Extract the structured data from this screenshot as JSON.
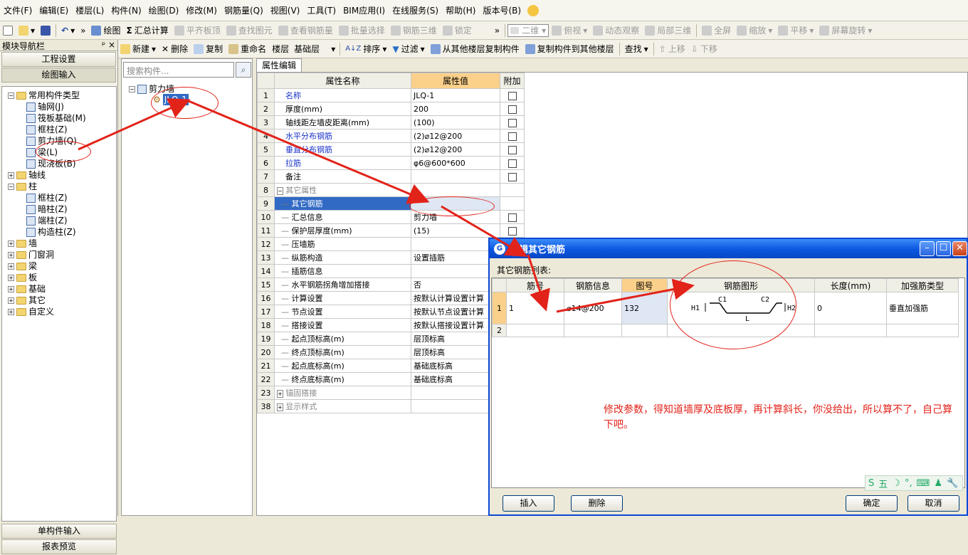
{
  "menu": [
    "文件(F)",
    "编辑(E)",
    "楼层(L)",
    "构件(N)",
    "绘图(D)",
    "修改(M)",
    "钢筋量(Q)",
    "视图(V)",
    "工具(T)",
    "BIM应用(I)",
    "在线服务(S)",
    "帮助(H)",
    "版本号(B)"
  ],
  "toolbar1": {
    "draw": "绘图",
    "calc": "汇总计算",
    "align_slab": "平齐板顶",
    "find_elem": "查找图元",
    "view_rebar": "查看钢筋量",
    "batch_select": "批量选择",
    "rebar_3d": "钢筋三维",
    "lock": "锁定",
    "view_mode": "二维",
    "top_view": "俯视",
    "dynamic_view": "动态观察",
    "local_3d": "局部三维",
    "fullscreen": "全屏",
    "zoom": "缩放",
    "pan": "平移",
    "rotate": "屏幕旋转"
  },
  "toolbar2": {
    "new": "新建",
    "delete": "删除",
    "copy": "复制",
    "rename": "重命名",
    "floor_label": "楼层",
    "floor_value": "基础层",
    "sort": "排序",
    "filter": "过滤",
    "copy_from": "从其他楼层复制构件",
    "copy_to": "复制构件到其他楼层",
    "find": "查找",
    "move_up": "上移",
    "move_down": "下移"
  },
  "nav": {
    "title": "模块导航栏",
    "pin": "ᵖ",
    "close": "×",
    "project_settings": "工程设置",
    "drawing_input": "绘图输入",
    "single_input": "单构件输入",
    "report_preview": "报表预览",
    "tree": [
      {
        "label": "常用构件类型",
        "level": 0,
        "type": "folder",
        "exp": "−"
      },
      {
        "label": "轴网(J)",
        "level": 1,
        "type": "comp"
      },
      {
        "label": "筏板基础(M)",
        "level": 1,
        "type": "comp"
      },
      {
        "label": "框柱(Z)",
        "level": 1,
        "type": "comp"
      },
      {
        "label": "剪力墙(Q)",
        "level": 1,
        "type": "comp"
      },
      {
        "label": "梁(L)",
        "level": 1,
        "type": "comp"
      },
      {
        "label": "现浇板(B)",
        "level": 1,
        "type": "comp"
      },
      {
        "label": "轴线",
        "level": 0,
        "type": "folder",
        "exp": "+"
      },
      {
        "label": "柱",
        "level": 0,
        "type": "folder",
        "exp": "−"
      },
      {
        "label": "框柱(Z)",
        "level": 1,
        "type": "comp"
      },
      {
        "label": "暗柱(Z)",
        "level": 1,
        "type": "comp"
      },
      {
        "label": "端柱(Z)",
        "level": 1,
        "type": "comp"
      },
      {
        "label": "构造柱(Z)",
        "level": 1,
        "type": "comp"
      },
      {
        "label": "墙",
        "level": 0,
        "type": "folder",
        "exp": "+"
      },
      {
        "label": "门窗洞",
        "level": 0,
        "type": "folder",
        "exp": "+"
      },
      {
        "label": "梁",
        "level": 0,
        "type": "folder",
        "exp": "+"
      },
      {
        "label": "板",
        "level": 0,
        "type": "folder",
        "exp": "+"
      },
      {
        "label": "基础",
        "level": 0,
        "type": "folder",
        "exp": "+"
      },
      {
        "label": "其它",
        "level": 0,
        "type": "folder",
        "exp": "+"
      },
      {
        "label": "自定义",
        "level": 0,
        "type": "folder",
        "exp": "+"
      }
    ]
  },
  "components": {
    "search_placeholder": "搜索构件...",
    "root": "剪力墙",
    "root_exp": "−",
    "item": "JLQ-1"
  },
  "props": {
    "tab": "属性编辑",
    "col_name": "属性名称",
    "col_value": "属性值",
    "col_extra": "附加",
    "rows": [
      {
        "n": "1",
        "name": "名称",
        "value": "JLQ-1",
        "chk": false,
        "blue": true,
        "indent": 0
      },
      {
        "n": "2",
        "name": "厚度(mm)",
        "value": "200",
        "chk": true,
        "indent": 0
      },
      {
        "n": "3",
        "name": "轴线距左墙皮距离(mm)",
        "value": "(100)",
        "chk": true,
        "indent": 0
      },
      {
        "n": "4",
        "name": "水平分布钢筋",
        "value": "(2)⌀12@200",
        "chk": true,
        "blue": true,
        "indent": 0
      },
      {
        "n": "5",
        "name": "垂直分布钢筋",
        "value": "(2)⌀12@200",
        "chk": true,
        "blue": true,
        "indent": 0
      },
      {
        "n": "6",
        "name": "拉筋",
        "value": "φ6@600*600",
        "chk": true,
        "blue": true,
        "indent": 0
      },
      {
        "n": "7",
        "name": "备注",
        "value": "",
        "chk": true,
        "indent": 0
      },
      {
        "n": "8",
        "name": "其它属性",
        "value": "",
        "chk": null,
        "gray": true,
        "indent": 0,
        "exp": "−"
      },
      {
        "n": "9",
        "name": "其它钢筋",
        "value": "",
        "chk": null,
        "indent": 1,
        "sel": true
      },
      {
        "n": "10",
        "name": "汇总信息",
        "value": "剪力墙",
        "chk": true,
        "indent": 1
      },
      {
        "n": "11",
        "name": "保护层厚度(mm)",
        "value": "(15)",
        "chk": true,
        "indent": 1
      },
      {
        "n": "12",
        "name": "压墙筋",
        "value": "",
        "chk": true,
        "indent": 1
      },
      {
        "n": "13",
        "name": "纵筋构造",
        "value": "设置插筋",
        "chk": true,
        "indent": 1
      },
      {
        "n": "14",
        "name": "插筋信息",
        "value": "",
        "chk": true,
        "indent": 1
      },
      {
        "n": "15",
        "name": "水平钢筋拐角增加搭接",
        "value": "否",
        "chk": true,
        "indent": 1
      },
      {
        "n": "16",
        "name": "计算设置",
        "value": "按默认计算设置计算",
        "chk": null,
        "indent": 1
      },
      {
        "n": "17",
        "name": "节点设置",
        "value": "按默认节点设置计算",
        "chk": null,
        "indent": 1
      },
      {
        "n": "18",
        "name": "搭接设置",
        "value": "按默认搭接设置计算",
        "chk": null,
        "indent": 1
      },
      {
        "n": "19",
        "name": "起点顶标高(m)",
        "value": "层顶标高",
        "chk": null,
        "indent": 1
      },
      {
        "n": "20",
        "name": "终点顶标高(m)",
        "value": "层顶标高",
        "chk": null,
        "indent": 1
      },
      {
        "n": "21",
        "name": "起点底标高(m)",
        "value": "基础底标高",
        "chk": null,
        "indent": 1
      },
      {
        "n": "22",
        "name": "终点底标高(m)",
        "value": "基础底标高",
        "chk": null,
        "indent": 1
      },
      {
        "n": "23",
        "name": "锚固搭接",
        "value": "",
        "chk": null,
        "gray": true,
        "indent": 0,
        "exp": "+"
      },
      {
        "n": "38",
        "name": "显示样式",
        "value": "",
        "chk": null,
        "gray": true,
        "indent": 0,
        "exp": "+"
      }
    ]
  },
  "dialog": {
    "title": "编辑其它钢筋",
    "list_label": "其它钢筋列表:",
    "columns": [
      "筋号",
      "钢筋信息",
      "图号",
      "钢筋图形",
      "长度(mm)",
      "加强筋类型"
    ],
    "rows": [
      {
        "n": "1",
        "bar": "1",
        "info": "⌀14@200",
        "fig": "132",
        "len": "0",
        "type": "垂直加强筋"
      },
      {
        "n": "2",
        "bar": "",
        "info": "",
        "fig": "",
        "len": "",
        "type": ""
      }
    ],
    "shape": {
      "h1": "H1",
      "c1": "C1",
      "c2": "C2",
      "h2": "H2",
      "l": "L"
    },
    "insert": "插入",
    "delete": "删除",
    "ok": "确定",
    "cancel": "取消",
    "ime": [
      "S",
      "五",
      "☽",
      "°,",
      "⌨",
      "♟",
      "🔧"
    ]
  },
  "annotation": "修改参数，得知道墙厚及底板厚，再计算斜长，你没给出，所以算不了，自己算下吧。",
  "colors": {
    "accent": "#316ac5",
    "annotation": "#e2231a",
    "title": "#0a56e0"
  }
}
